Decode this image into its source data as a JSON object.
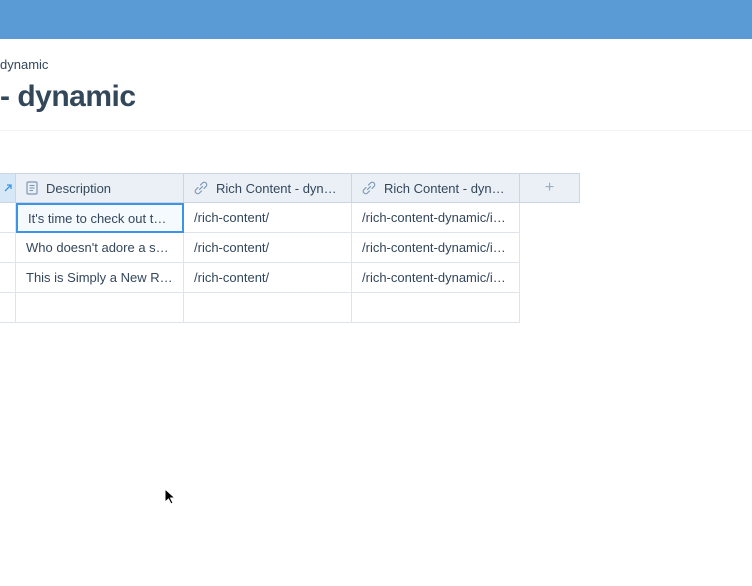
{
  "breadcrumb": "dynamic",
  "page_title": "- dynamic",
  "columns": {
    "description": {
      "label": "Description",
      "icon": "description-icon"
    },
    "rc1": {
      "label": "Rich Content - dynam…",
      "icon": "link-icon"
    },
    "rc2": {
      "label": "Rich Content - dynam…",
      "icon": "link-icon"
    },
    "add": {
      "label": "+"
    }
  },
  "rows": [
    {
      "selected": true,
      "description": "It's time to check out the …",
      "rc1": "/rich-content/",
      "rc2": "/rich-content-dynamic/i-a…"
    },
    {
      "selected": false,
      "description": "Who doesn't adore a smili…",
      "rc1": "/rich-content/",
      "rc2": "/rich-content-dynamic/i-a…"
    },
    {
      "selected": false,
      "description": "This is Simply a New Rich …",
      "rc1": "/rich-content/",
      "rc2": "/rich-content-dynamic/i-a…"
    }
  ]
}
